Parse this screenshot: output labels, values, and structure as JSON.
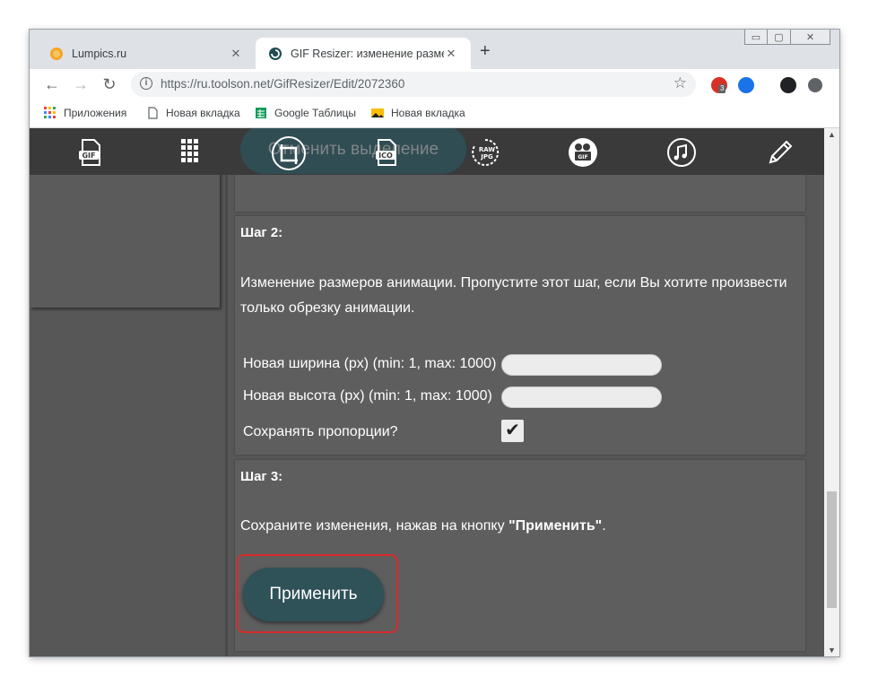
{
  "browser": {
    "tabs": [
      {
        "title": "Lumpics.ru",
        "close": "✕"
      },
      {
        "title": "GIF Resizer: изменение размера",
        "close": "✕"
      }
    ],
    "new_tab": "+",
    "window_controls": {
      "minimize": "▭",
      "maximize": "▢",
      "close": "✕"
    },
    "url": "https://ru.toolson.net/GifResizer/Edit/2072360",
    "extension_badge": "3",
    "bookmarks": [
      "Приложения",
      "Новая вкладка",
      "Google Таблицы",
      "Новая вкладка"
    ]
  },
  "toolbar_icons": [
    "gif-icon",
    "frames-grid-icon",
    "crop-icon",
    "ico-icon",
    "raw-jpg-icon",
    "video-gif-icon",
    "music-icon",
    "pencil-icon"
  ],
  "page": {
    "cancel_button": "Отменить выделение",
    "step2": {
      "heading": "Шаг 2:",
      "desc_line1": "Изменение размеров анимации. Пропустите этот шаг, если Вы хотите произвести",
      "desc_line2": "только обрезку анимации.",
      "width_label": "Новая ширина (px) (min: 1, max: 1000)",
      "width_value": "",
      "height_label": "Новая высота (px) (min: 1, max: 1000)",
      "height_value": "",
      "keep_ratio_label": "Сохранять пропорции?",
      "keep_ratio_checked": true
    },
    "step3": {
      "heading": "Шаг 3:",
      "desc_prefix": "Сохраните изменения, нажав на кнопку ",
      "desc_bold": "\"Применить\"",
      "desc_suffix": ".",
      "apply_button": "Применить"
    }
  },
  "colors": {
    "accent_button": "#2f5158",
    "highlight": "#d92a2a",
    "page_bg": "#575757"
  }
}
